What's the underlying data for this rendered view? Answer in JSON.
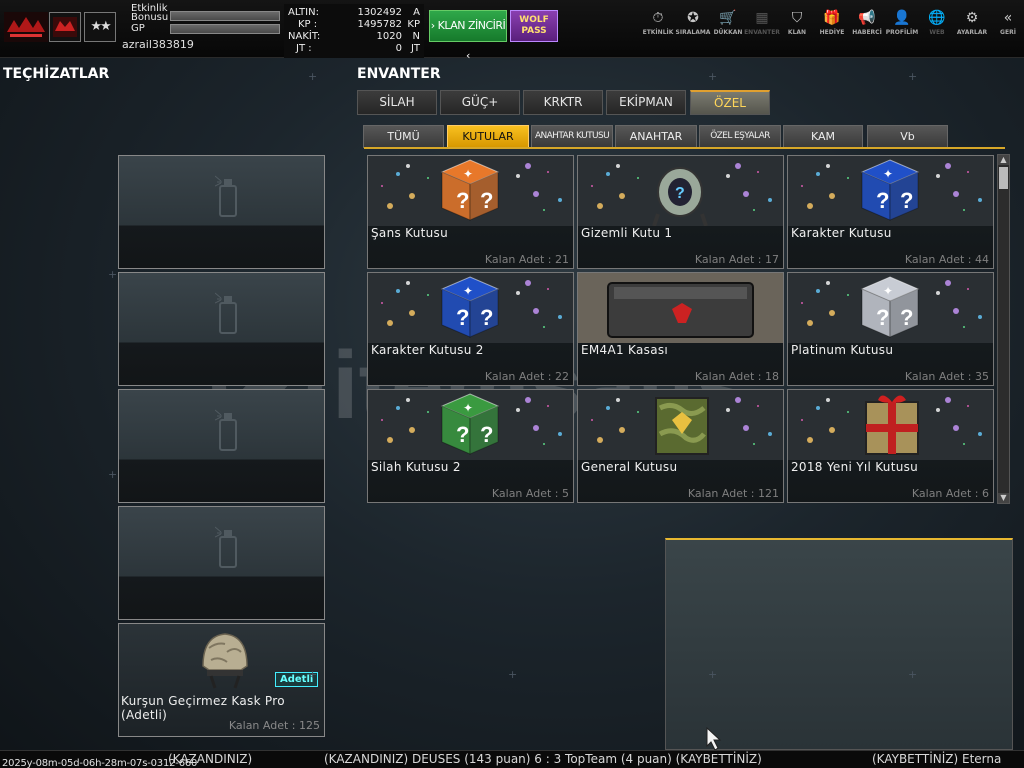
{
  "player": {
    "etkinlik_label": "Etkinlik",
    "bonusu_label": "Bonusu",
    "gp_label": "GP",
    "username": "azrail383819",
    "rank_stars": "★★"
  },
  "currency": [
    {
      "label": "ALTIN:",
      "value": "1302492",
      "unit": "A"
    },
    {
      "label": "KP :",
      "value": "1495782",
      "unit": "KP"
    },
    {
      "label": "NAKİT:",
      "value": "1020",
      "unit": "N"
    },
    {
      "label": "JT :",
      "value": "0",
      "unit": "JT"
    }
  ],
  "buttons": {
    "klan_zinciri": "› KLAN ZİNCİRİ ‹",
    "wolf_pass_line1": "WOLF",
    "wolf_pass_line2": "PASS"
  },
  "nav": [
    {
      "label": "ETKİNLİK",
      "icon": "stopwatch-icon",
      "glyph": "⏱",
      "enabled": true
    },
    {
      "label": "SIRALAMA",
      "icon": "medal-icon",
      "glyph": "✪",
      "enabled": true
    },
    {
      "label": "DÜKKAN",
      "icon": "cart-icon",
      "glyph": "🛒",
      "enabled": true
    },
    {
      "label": "ENVANTER",
      "icon": "inventory-icon",
      "glyph": "▦",
      "enabled": false
    },
    {
      "label": "KLAN",
      "icon": "shield-icon",
      "glyph": "⛉",
      "enabled": true
    },
    {
      "label": "HEDİYE",
      "icon": "gift-icon",
      "glyph": "🎁",
      "enabled": true
    },
    {
      "label": "HABERCİ",
      "icon": "megaphone-icon",
      "glyph": "📢",
      "enabled": true
    },
    {
      "label": "PROFİLİM",
      "icon": "profile-icon",
      "glyph": "👤",
      "enabled": true
    },
    {
      "label": "WEB",
      "icon": "globe-icon",
      "glyph": "🌐",
      "enabled": false
    },
    {
      "label": "AYARLAR",
      "icon": "gear-icon",
      "glyph": "⚙",
      "enabled": true
    },
    {
      "label": "GERİ",
      "icon": "back-icon",
      "glyph": "«",
      "enabled": true
    }
  ],
  "sections": {
    "equipment_title": "TEÇHİZATLAR",
    "inventory_title": "ENVANTER"
  },
  "equipment_slots": [
    {
      "name": "",
      "qty": ""
    },
    {
      "name": "",
      "qty": ""
    },
    {
      "name": "",
      "qty": ""
    },
    {
      "name": "",
      "qty": ""
    },
    {
      "name": "Kurşun Geçirmez Kask Pro (Adetli)",
      "qty": "Kalan Adet : 125",
      "badge": "Adetli"
    }
  ],
  "tabs": [
    {
      "label": "SİLAH",
      "active": false
    },
    {
      "label": "GÜÇ+",
      "active": false
    },
    {
      "label": "KRKTR",
      "active": false
    },
    {
      "label": "EKİPMAN",
      "active": false
    },
    {
      "label": "ÖZEL",
      "active": true
    }
  ],
  "subtabs": [
    {
      "label": "TÜMÜ",
      "active": false
    },
    {
      "label": "KUTULAR",
      "active": true
    },
    {
      "label": "ANAHTAR KUTUSU",
      "active": false
    },
    {
      "label": "ANAHTAR",
      "active": false
    },
    {
      "label": "ÖZEL EŞYALAR",
      "active": false
    },
    {
      "label": "KAM",
      "active": false
    },
    {
      "label": "Vb",
      "active": false
    }
  ],
  "items": [
    {
      "name": "Şans Kutusu",
      "qty": "Kalan Adet : 21",
      "art": "orange-box-icon",
      "color": "#e8782a"
    },
    {
      "name": "Gizemli Kutu 1",
      "qty": "Kalan Adet : 17",
      "art": "mystery-capsule-icon",
      "color": "#a8c0a8"
    },
    {
      "name": "Karakter Kutusu",
      "qty": "Kalan Adet : 44",
      "art": "blue-box-icon",
      "color": "#2050c8"
    },
    {
      "name": "Karakter Kutusu 2",
      "qty": "Kalan Adet : 22",
      "art": "blue-box-icon",
      "color": "#2050c8"
    },
    {
      "name": "EM4A1 Kasası",
      "qty": "Kalan Adet : 18",
      "art": "weapon-case-icon",
      "color": "#555555"
    },
    {
      "name": "Platinum Kutusu",
      "qty": "Kalan Adet : 35",
      "art": "silver-box-icon",
      "color": "#c8ccd4"
    },
    {
      "name": "Silah Kutusu 2",
      "qty": "Kalan Adet : 5",
      "art": "green-box-icon",
      "color": "#3a9a40"
    },
    {
      "name": "General Kutusu",
      "qty": "Kalan Adet : 121",
      "art": "camo-box-icon",
      "color": "#6a7a3a"
    },
    {
      "name": "2018 Yeni Yıl Kutusu",
      "qty": "Kalan Adet : 6",
      "art": "gift-box-icon",
      "color": "#a88a50"
    }
  ],
  "watermark_text": "itemsatis",
  "ticker": {
    "part1": "(KAZANDINIZ)",
    "part2": "(KAZANDINIZ) DEUSES (143 puan) 6 : 3 TopTeam (4 puan) (KAYBETTİNİZ)",
    "part3": "(KAYBETTİNİZ) Eterna",
    "stamp": "2025y-08m-05d-06h-28m-07s-0312-660"
  }
}
